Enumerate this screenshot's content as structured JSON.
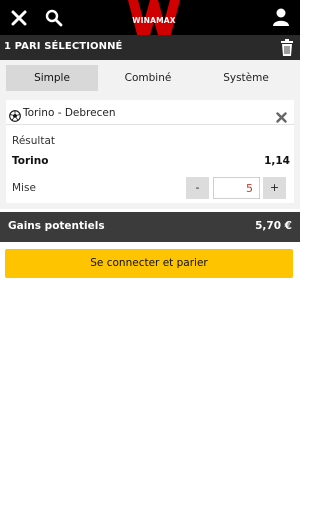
{
  "header": {
    "logo_text": "WINAMAX",
    "icons": {
      "close": "close-icon",
      "search": "search-icon",
      "user": "user-icon"
    }
  },
  "selection_bar": {
    "title": "1 PARI SÉLECTIONNÉ",
    "trash_icon": "trash-icon"
  },
  "tabs": [
    {
      "label": "Simple",
      "active": true
    },
    {
      "label": "Combiné",
      "active": false
    },
    {
      "label": "Système",
      "active": false
    }
  ],
  "bet": {
    "match": "Torino - Debrecen",
    "sport_icon": "soccer-ball-icon",
    "market": "Résultat",
    "selection": "Torino",
    "odds": "1,14",
    "stake_label": "Mise",
    "stake_value": "5",
    "minus": "-",
    "plus": "+"
  },
  "gains": {
    "label": "Gains potentiels",
    "value": "5,70 €"
  },
  "connect_button": {
    "label": "Se connecter et parier"
  },
  "colors": {
    "topbar": "#000000",
    "selection_bar": "#2a2a2a",
    "gains_bar": "#3b3b3b",
    "accent_yellow": "#ffc400",
    "logo_red": "#d10000",
    "stake_text": "#c0392b"
  }
}
